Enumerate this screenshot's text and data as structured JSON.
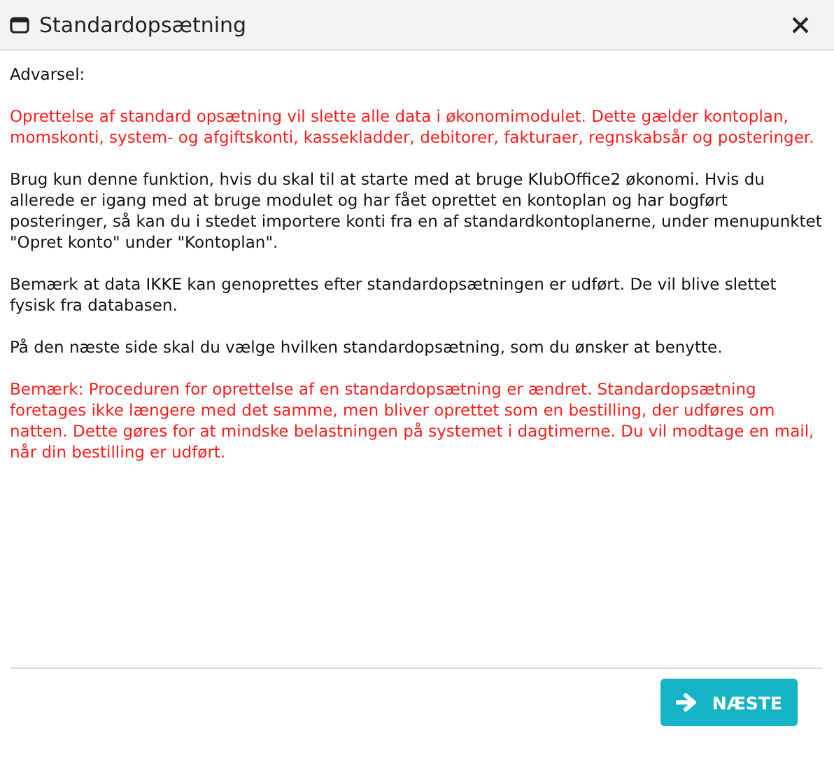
{
  "window": {
    "title": "Standardopsætning"
  },
  "heading": "Advarsel:",
  "paragraphs": [
    {
      "kind": "warning",
      "text": "Oprettelse af standard opsætning vil slette alle data i økonomimodulet. Dette gælder kontoplan, momskonti, system- og afgiftskonti, kassekladder, debitorer, fakturaer, regnskabsår og posteringer."
    },
    {
      "kind": "normal",
      "text": "Brug kun denne funktion, hvis du skal til at starte med at bruge KlubOffice2 økonomi. Hvis du allerede er igang med at bruge modulet og har fået oprettet en kontoplan og har bogført posteringer, så kan du i stedet importere konti fra en af standardkontoplanerne, under menupunktet \"Opret konto\" under \"Kontoplan\"."
    },
    {
      "kind": "normal",
      "text": "Bemærk at data IKKE kan genoprettes efter standardopsætningen er udført. De vil blive slettet fysisk fra databasen."
    },
    {
      "kind": "normal",
      "text": "På den næste side skal du vælge hvilken standardopsætning, som du ønsker at benytte."
    },
    {
      "kind": "warning",
      "text": "Bemærk: Proceduren for oprettelse af en standardopsætning er ændret. Standardopsætning foretages ikke længere med det samme, men bliver oprettet som en bestilling, der udføres om natten. Dette gøres for at mindske belastningen på systemet i dagtimerne. Du vil modtage en mail, når din bestilling er udført."
    }
  ],
  "next_button": "NÆSTE"
}
